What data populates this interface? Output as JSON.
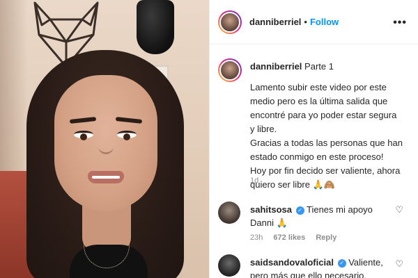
{
  "post": {
    "author": "danniberriel",
    "separator": "•",
    "follow_label": "Follow",
    "more_icon": "more-horizontal-icon"
  },
  "caption": {
    "author": "danniberriel",
    "title": "Parte 1",
    "line1": "Lamento subir este video por este medio pero es la última salida que encontré para yo poder estar segura y libre.",
    "line2": "Gracias a todas las personas que han estado conmigo en este proceso!",
    "line3": "Hoy por fin decido ser valiente, ahora quiero ser libre",
    "line3_emoji": "🙏🙈",
    "time": "1d"
  },
  "comments": [
    {
      "author": "sahitsosa",
      "text": "Tienes mi apoyo Danni",
      "emoji": "🙏",
      "time": "23h",
      "likes": "672 likes",
      "reply": "Reply",
      "verified": true
    },
    {
      "author": "saidsandovaloficial",
      "text": "Valiente, pero más que ello necesario.",
      "verified": true
    }
  ],
  "colors": {
    "link_blue": "#0095f6",
    "verified_blue": "#3897f0",
    "muted": "#8e8e8e"
  }
}
